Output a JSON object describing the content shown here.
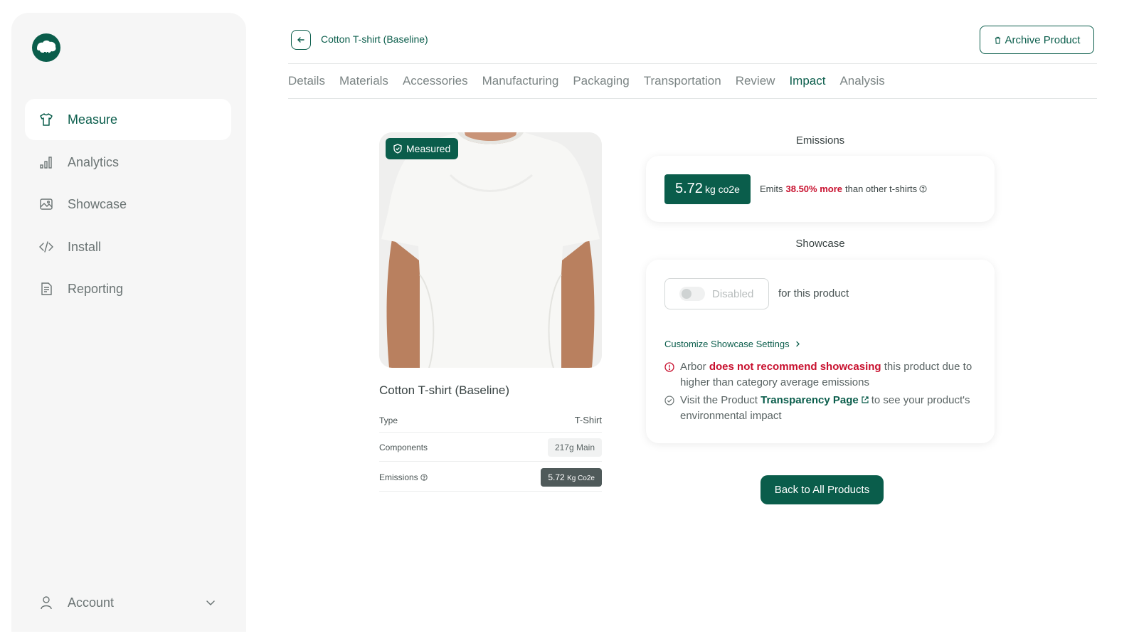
{
  "sidebar": {
    "items": [
      {
        "label": "Measure",
        "icon": "tshirt-icon"
      },
      {
        "label": "Analytics",
        "icon": "bar-chart-icon"
      },
      {
        "label": "Showcase",
        "icon": "image-icon"
      },
      {
        "label": "Install",
        "icon": "code-icon"
      },
      {
        "label": "Reporting",
        "icon": "report-icon"
      }
    ],
    "account_label": "Account"
  },
  "header": {
    "title": "Cotton T-shirt (Baseline)",
    "archive_label": "Archive Product"
  },
  "tabs": [
    {
      "label": "Details"
    },
    {
      "label": "Materials"
    },
    {
      "label": "Accessories"
    },
    {
      "label": "Manufacturing"
    },
    {
      "label": "Packaging"
    },
    {
      "label": "Transportation"
    },
    {
      "label": "Review"
    },
    {
      "label": "Impact"
    },
    {
      "label": "Analysis"
    }
  ],
  "product": {
    "badge": "Measured",
    "name": "Cotton T-shirt (Baseline)",
    "specs": {
      "type_label": "Type",
      "type_value": "T-Shirt",
      "components_label": "Components",
      "components_value": "217g Main",
      "emissions_label": "Emissions",
      "emissions_value": "5.72",
      "emissions_unit": "Kg Co2e"
    }
  },
  "emissions": {
    "title": "Emissions",
    "value": "5.72",
    "unit": "kg co2e",
    "text_prefix": "Emits",
    "text_highlight": "38.50% more",
    "text_suffix": "than other t-shirts"
  },
  "showcase": {
    "title": "Showcase",
    "toggle_label": "Disabled",
    "for_product": "for this product",
    "customize_link": "Customize Showcase Settings",
    "warning_prefix": "Arbor",
    "warning_highlight": "does not recommend showcasing",
    "warning_suffix": "this product due to higher than category average emissions",
    "visit_prefix": "Visit the Product",
    "visit_link": "Transparency Page",
    "visit_suffix": "to see your product's environmental impact"
  },
  "footer": {
    "back_all_label": "Back to All Products"
  },
  "colors": {
    "brand": "#0a5d4b",
    "warning": "#c8102e"
  }
}
